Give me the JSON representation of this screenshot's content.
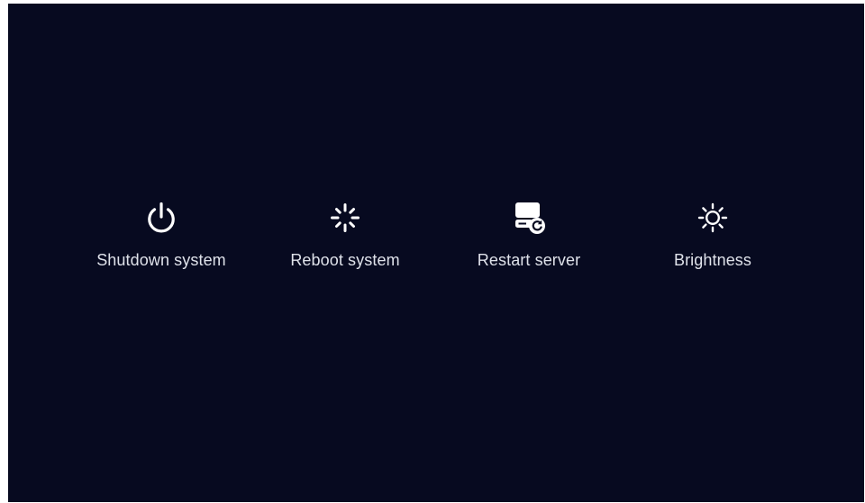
{
  "actions": [
    {
      "id": "shutdown",
      "label": "Shutdown system",
      "icon": "power-icon"
    },
    {
      "id": "reboot",
      "label": "Reboot system",
      "icon": "loading-spinner-icon"
    },
    {
      "id": "restart",
      "label": "Restart server",
      "icon": "server-restart-icon"
    },
    {
      "id": "brightness",
      "label": "Brightness",
      "icon": "sun-icon"
    }
  ],
  "colors": {
    "background": "#070a20",
    "foreground": "#ffffff",
    "label": "#dfe2ea"
  }
}
